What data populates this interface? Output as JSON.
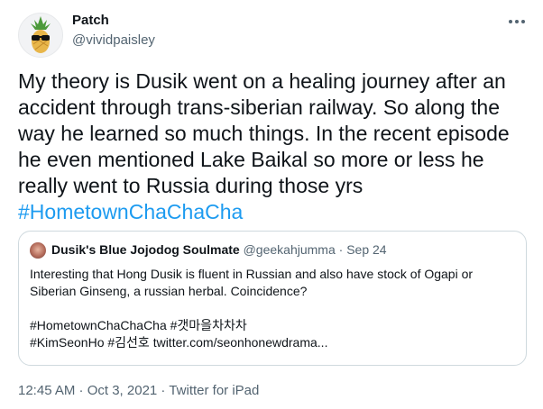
{
  "author": {
    "name": "Patch",
    "handle": "@vividpaisley",
    "avatar_icon": "pineapple-sunglasses-avatar-icon"
  },
  "tweet": {
    "text": "My theory is Dusik went on a healing journey after an accident through trans-siberian railway. So along the way he learned so much things. In the recent episode he even mentioned Lake Baikal so more or less he really went to Russia during those yrs",
    "hashtag": "#HometownChaChaCha"
  },
  "quoted": {
    "display_name": "Dusik's Blue Jojodog Soulmate",
    "handle": "@geekahjumma",
    "separator": "·",
    "date": "Sep 24",
    "text": "Interesting that Hong Dusik is fluent in Russian and also have stock of Ogapi or Siberian Ginseng, a russian herbal. Coincidence?",
    "tags_line1": "#HometownChaChaCha #갯마을차차차",
    "tags_line2": "#KimSeonHo #김선호 twitter.com/seonhonewdrama..."
  },
  "footer": {
    "timestamp": "12:45 AM · Oct 3, 2021 · Twitter for iPad"
  },
  "colors": {
    "link": "#1d9bf0",
    "secondary_text": "#536471",
    "border": "#cfd9de"
  }
}
